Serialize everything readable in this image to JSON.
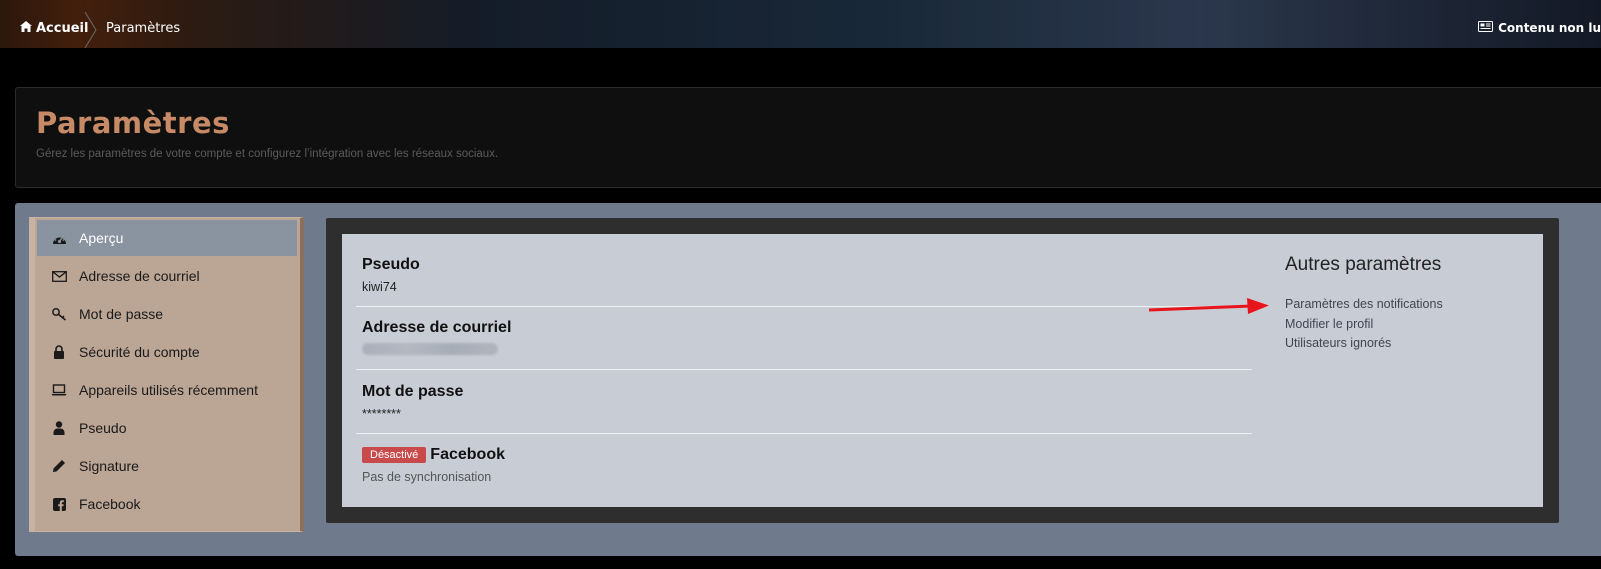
{
  "breadcrumb": {
    "home_label": "Accueil",
    "current_label": "Paramètres"
  },
  "topbar": {
    "unread_label": "Contenu non lu"
  },
  "header": {
    "title": "Paramètres",
    "description": "Gérez les paramètres de votre compte et configurez l’intégration avec les réseaux sociaux."
  },
  "sidebar": {
    "items": [
      {
        "label": "Aperçu",
        "icon": "dashboard-icon",
        "active": true
      },
      {
        "label": "Adresse de courriel",
        "icon": "envelope-icon"
      },
      {
        "label": "Mot de passe",
        "icon": "key-icon"
      },
      {
        "label": "Sécurité du compte",
        "icon": "lock-icon"
      },
      {
        "label": "Appareils utilisés récemment",
        "icon": "laptop-icon"
      },
      {
        "label": "Pseudo",
        "icon": "user-icon"
      },
      {
        "label": "Signature",
        "icon": "pencil-icon"
      },
      {
        "label": "Facebook",
        "icon": "facebook-icon"
      }
    ]
  },
  "overview": {
    "pseudo": {
      "title": "Pseudo",
      "value": "kiwi74"
    },
    "email": {
      "title": "Adresse de courriel"
    },
    "password": {
      "title": "Mot de passe",
      "value": "********"
    },
    "facebook": {
      "badge": "Désactivé",
      "title": "Facebook",
      "status": "Pas de synchronisation"
    }
  },
  "other_settings": {
    "title": "Autres paramètres",
    "links": [
      "Paramètres des notifications",
      "Modifier le profil",
      "Utilisateurs ignorés"
    ]
  },
  "colors": {
    "accent_title": "#c78a66",
    "badge_red": "#c94a4a",
    "annotation_arrow": "#e8141c"
  }
}
